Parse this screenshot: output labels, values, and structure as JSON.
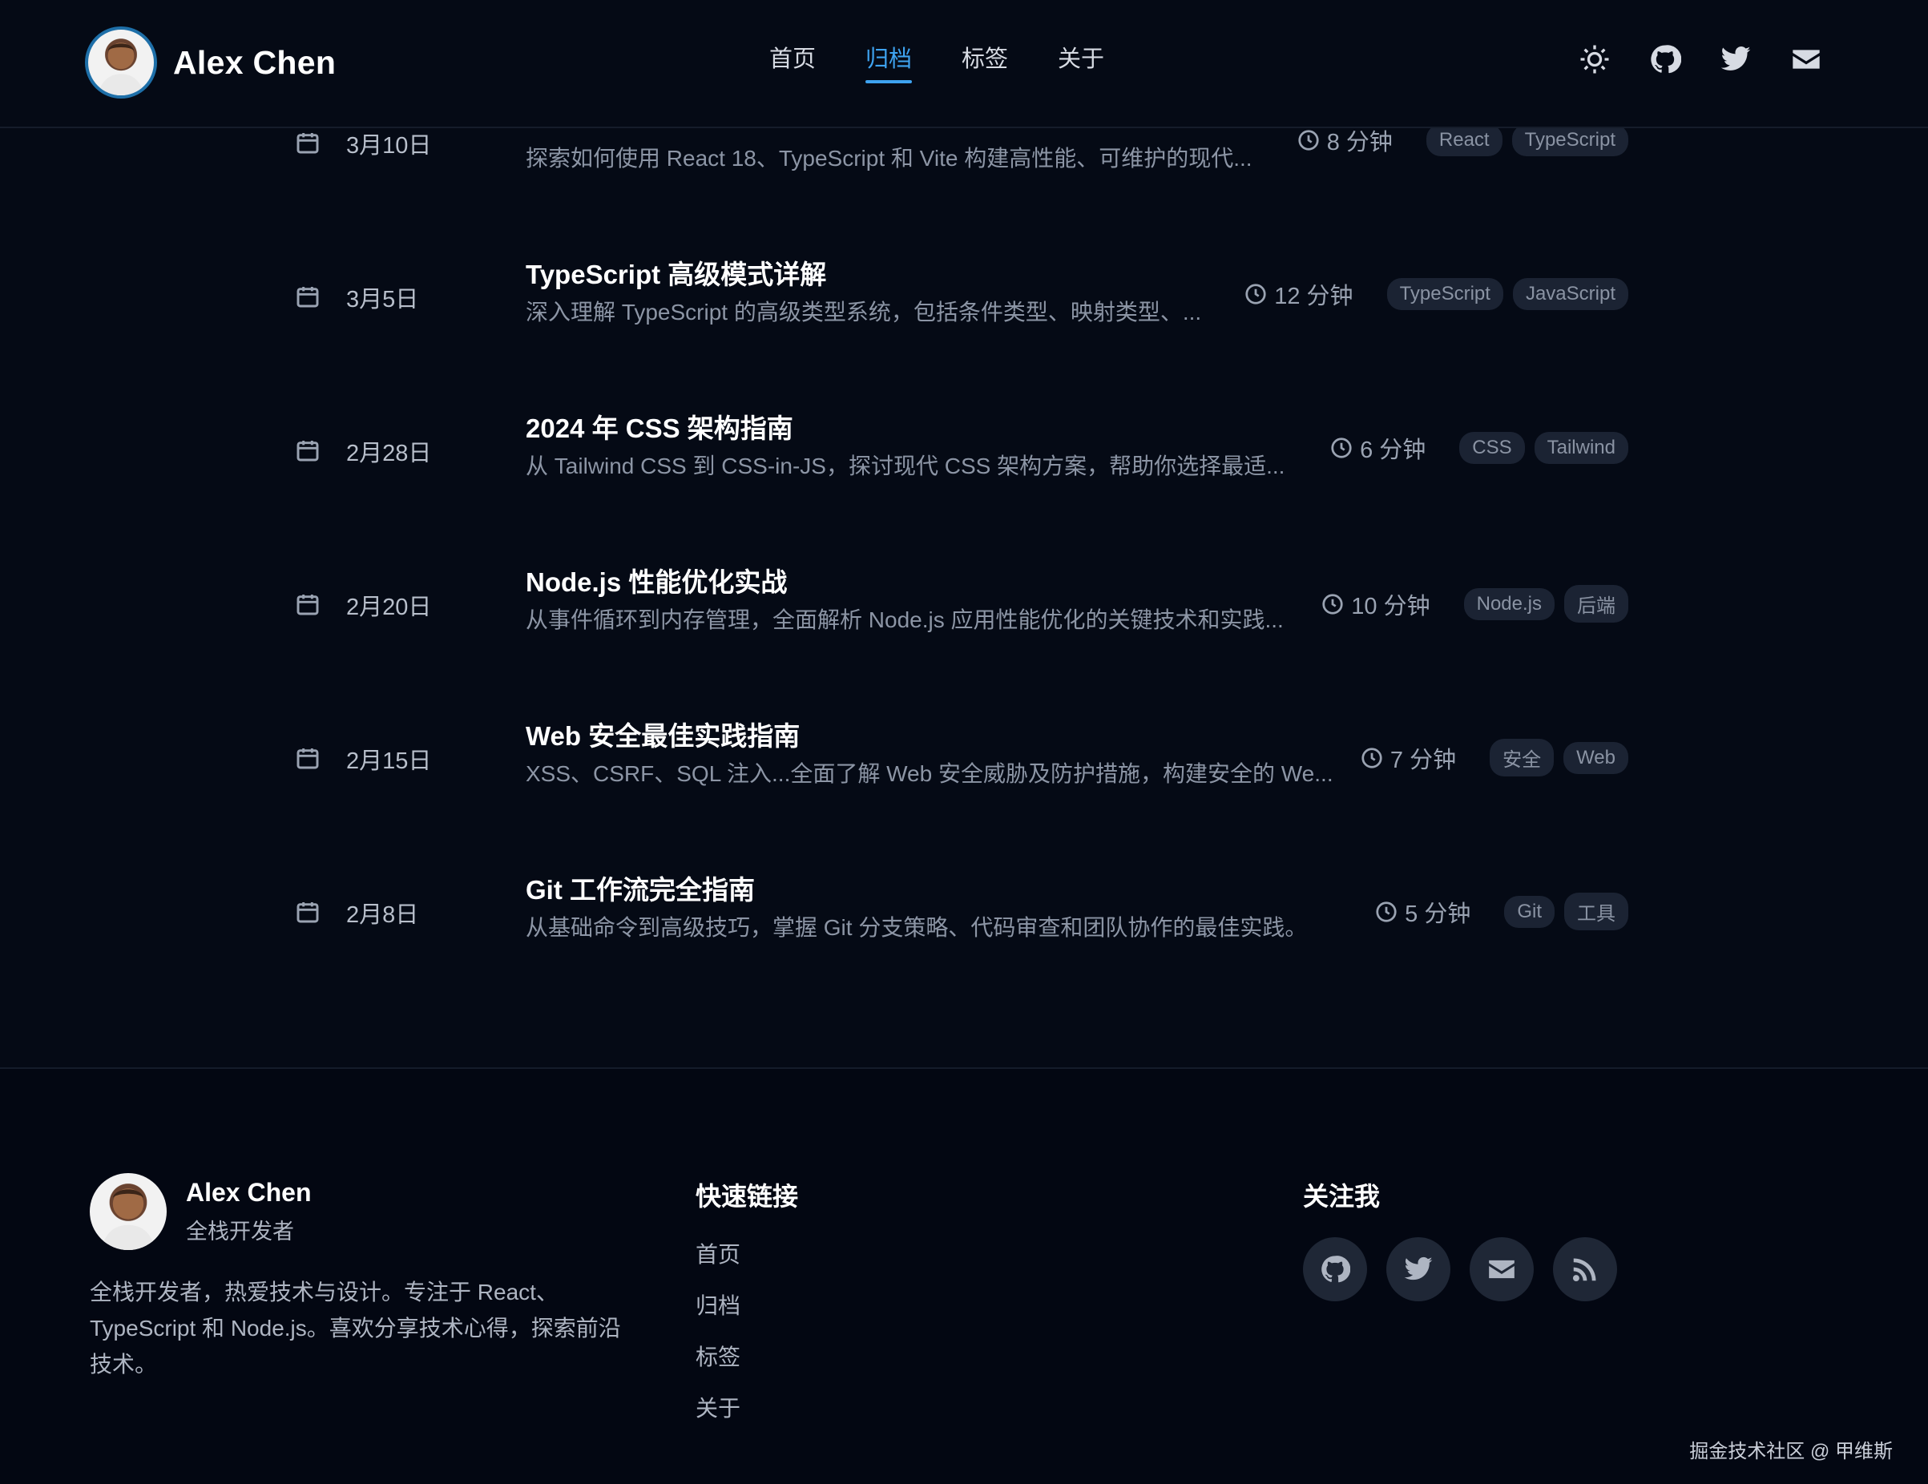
{
  "site": {
    "name": "Alex Chen"
  },
  "nav": [
    {
      "label": "首页"
    },
    {
      "label": "归档",
      "active": true
    },
    {
      "label": "标签"
    },
    {
      "label": "关于"
    }
  ],
  "header_icons": [
    "sun-icon",
    "github-icon",
    "twitter-icon",
    "mail-icon"
  ],
  "posts": [
    {
      "date": "3月10日",
      "title": "",
      "excerpt": "探索如何使用 React 18、TypeScript 和 Vite 构建高性能、可维护的现代...",
      "read_time": "8 分钟",
      "tags": [
        "React",
        "TypeScript"
      ]
    },
    {
      "date": "3月5日",
      "title": "TypeScript 高级模式详解",
      "excerpt": "深入理解 TypeScript 的高级类型系统，包括条件类型、映射类型、...",
      "read_time": "12 分钟",
      "tags": [
        "TypeScript",
        "JavaScript"
      ]
    },
    {
      "date": "2月28日",
      "title": "2024 年 CSS 架构指南",
      "excerpt": "从 Tailwind CSS 到 CSS-in-JS，探讨现代 CSS 架构方案，帮助你选择最适...",
      "read_time": "6 分钟",
      "tags": [
        "CSS",
        "Tailwind"
      ]
    },
    {
      "date": "2月20日",
      "title": "Node.js 性能优化实战",
      "excerpt": "从事件循环到内存管理，全面解析 Node.js 应用性能优化的关键技术和实践...",
      "read_time": "10 分钟",
      "tags": [
        "Node.js",
        "后端"
      ]
    },
    {
      "date": "2月15日",
      "title": "Web 安全最佳实践指南",
      "excerpt": "XSS、CSRF、SQL 注入...全面了解 Web 安全威胁及防护措施，构建安全的 We...",
      "read_time": "7 分钟",
      "tags": [
        "安全",
        "Web"
      ]
    },
    {
      "date": "2月8日",
      "title": "Git 工作流完全指南",
      "excerpt": "从基础命令到高级技巧，掌握 Git 分支策略、代码审查和团队协作的最佳实践。",
      "read_time": "5 分钟",
      "tags": [
        "Git",
        "工具"
      ]
    }
  ],
  "footer": {
    "name": "Alex Chen",
    "role": "全栈开发者",
    "bio": "全栈开发者，热爱技术与设计。专注于 React、TypeScript 和 Node.js。喜欢分享技术心得，探索前沿技术。",
    "quick_links_title": "快速链接",
    "quick_links": [
      "首页",
      "归档",
      "标签",
      "关于"
    ],
    "follow_title": "关注我",
    "social_icons": [
      "github-icon",
      "twitter-icon",
      "mail-icon",
      "rss-icon"
    ]
  },
  "watermark": "掘金技术社区 @ 甲维斯",
  "colors": {
    "accent": "#3ea3f0",
    "background": "#050a15",
    "tag_bg": "#1b2333"
  }
}
